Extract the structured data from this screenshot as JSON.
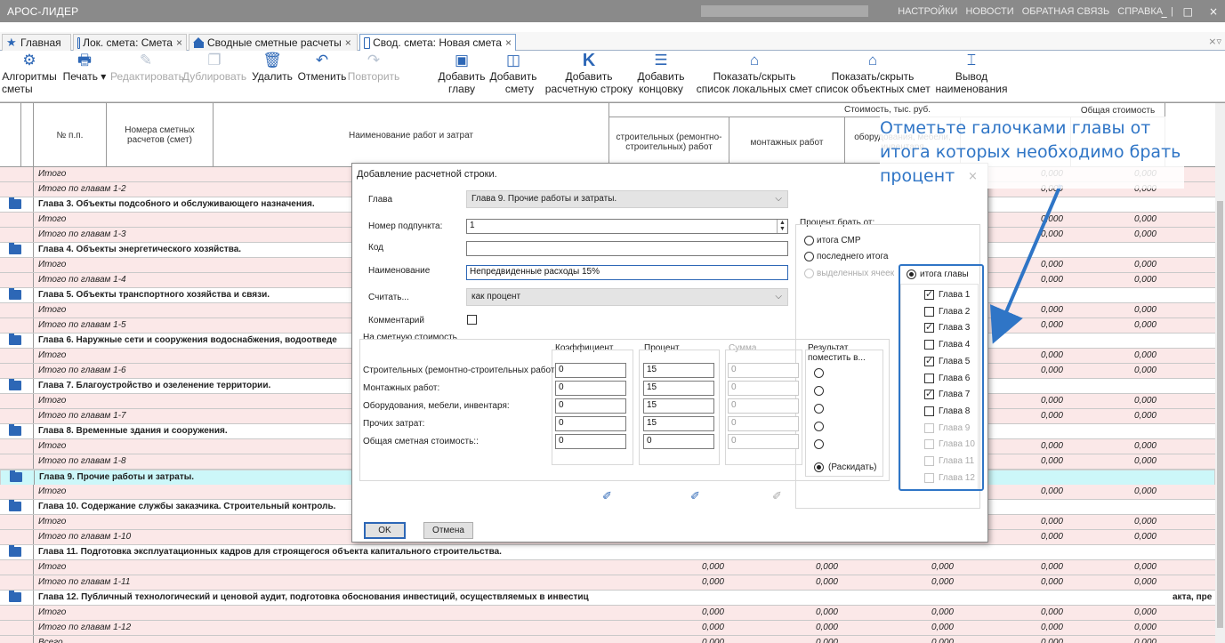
{
  "app": {
    "title": "АРОС-ЛИДЕР"
  },
  "menu": [
    "НАСТРОЙКИ",
    "НОВОСТИ",
    "ОБРАТНАЯ СВЯЗЬ",
    "СПРАВКА"
  ],
  "window_controls": {
    "minimize": "_",
    "maximize": "□",
    "close": "×"
  },
  "tabs": [
    {
      "label": "Главная",
      "icon": "star-icon"
    },
    {
      "label": "Лок. смета: Смета",
      "icon": "document-icon",
      "close": "×"
    },
    {
      "label": "Сводные сметные расчеты",
      "icon": "home-icon",
      "close": "×"
    },
    {
      "label": "Свод. смета: Новая смета",
      "icon": "document-icon",
      "close": "×",
      "active": true
    }
  ],
  "tabbar_controls": "×▿",
  "toolbar": [
    {
      "label1": "Алгоритмы",
      "label2": "сметы",
      "icon": "⚙"
    },
    {
      "label1": "Печать ▾",
      "label2": "",
      "icon": "🖶"
    },
    {
      "label1": "Редактировать",
      "label2": "",
      "icon": "✎",
      "disabled": true
    },
    {
      "label1": "Дублировать",
      "label2": "",
      "icon": "❐",
      "disabled": true
    },
    {
      "label1": "Удалить",
      "label2": "",
      "icon": "🗑"
    },
    {
      "label1": "Отменить",
      "label2": "",
      "icon": "↶"
    },
    {
      "label1": "Повторить",
      "label2": "",
      "icon": "↷",
      "disabled": true
    },
    {
      "label1": "Добавить",
      "label2": "главу",
      "icon": "▣"
    },
    {
      "label1": "Добавить",
      "label2": "смету",
      "icon": "◫"
    },
    {
      "label1": "Добавить",
      "label2": "расчетную строку",
      "icon": "K"
    },
    {
      "label1": "Добавить",
      "label2": "концовку",
      "icon": "☰"
    },
    {
      "label1": "Показать/скрыть",
      "label2": "список локальных смет",
      "icon": "⌂"
    },
    {
      "label1": "Показать/скрыть",
      "label2": "список объектных смет",
      "icon": "⌂"
    },
    {
      "label1": "Вывод",
      "label2": "наименования",
      "icon": "⌶"
    }
  ],
  "grid_header": {
    "num": "№ п.п.",
    "numbers": "Номера сметных расчетов (смет)",
    "name": "Наименование работ и затрат",
    "cost_group": "Стоимость, тыс. руб.",
    "col_build": "строительных (ремонтно-строительных) работ",
    "col_mount": "монтажных работ",
    "col_equip": "оборудования, мебели, инвентаря",
    "col_total": "Общая стоимость"
  },
  "rows": [
    {
      "type": "itogo",
      "name": "Итого",
      "values": [
        "",
        "",
        "",
        "0,000",
        "0,000"
      ]
    },
    {
      "type": "itogo",
      "name": "Итого по главам 1-2",
      "values": [
        "",
        "",
        "",
        "0,000",
        "0,000"
      ]
    },
    {
      "type": "chapter",
      "name": "Глава 3. Объекты подсобного и обслуживающего назначения."
    },
    {
      "type": "itogo",
      "name": "Итого",
      "values": [
        "",
        "",
        "",
        "0,000",
        "0,000"
      ]
    },
    {
      "type": "itogo",
      "name": "Итого по главам 1-3",
      "values": [
        "",
        "",
        "",
        "0,000",
        "0,000"
      ]
    },
    {
      "type": "chapter",
      "name": "Глава 4. Объекты энергетического хозяйства."
    },
    {
      "type": "itogo",
      "name": "Итого",
      "values": [
        "",
        "",
        "",
        "0,000",
        "0,000"
      ]
    },
    {
      "type": "itogo",
      "name": "Итого по главам 1-4",
      "values": [
        "",
        "",
        "",
        "0,000",
        "0,000"
      ]
    },
    {
      "type": "chapter",
      "name": "Глава 5. Объекты транспортного хозяйства и связи."
    },
    {
      "type": "itogo",
      "name": "Итого",
      "values": [
        "",
        "",
        "",
        "0,000",
        "0,000"
      ]
    },
    {
      "type": "itogo",
      "name": "Итого по главам 1-5",
      "values": [
        "",
        "",
        "",
        "0,000",
        "0,000"
      ]
    },
    {
      "type": "chapter",
      "name": "Глава 6. Наружные сети и сооружения водоснабжения, водоотведе"
    },
    {
      "type": "itogo",
      "name": "Итого",
      "values": [
        "",
        "",
        "",
        "0,000",
        "0,000"
      ]
    },
    {
      "type": "itogo",
      "name": "Итого по главам 1-6",
      "values": [
        "",
        "",
        "",
        "0,000",
        "0,000"
      ]
    },
    {
      "type": "chapter",
      "name": "Глава 7. Благоустройство и озеленение территории."
    },
    {
      "type": "itogo",
      "name": "Итого",
      "values": [
        "",
        "",
        "",
        "0,000",
        "0,000"
      ]
    },
    {
      "type": "itogo",
      "name": "Итого по главам 1-7",
      "values": [
        "",
        "",
        "",
        "0,000",
        "0,000"
      ]
    },
    {
      "type": "chapter",
      "name": "Глава 8. Временные здания и сооружения."
    },
    {
      "type": "itogo",
      "name": "Итого",
      "values": [
        "",
        "",
        "",
        "0,000",
        "0,000"
      ]
    },
    {
      "type": "itogo",
      "name": "Итого по главам 1-8",
      "values": [
        "",
        "",
        "",
        "0,000",
        "0,000"
      ]
    },
    {
      "type": "chapter",
      "name": "Глава 9. Прочие работы и затраты.",
      "selected": true
    },
    {
      "type": "itogo",
      "name": "Итого",
      "values": [
        "",
        "",
        "",
        "0,000",
        "0,000"
      ]
    },
    {
      "type": "chapter",
      "name": "Глава 10. Содержание службы заказчика. Строительный контроль."
    },
    {
      "type": "itogo",
      "name": "Итого",
      "values": [
        "",
        "",
        "",
        "0,000",
        "0,000"
      ]
    },
    {
      "type": "itogo",
      "name": "Итого по главам 1-10",
      "values": [
        "",
        "",
        "",
        "0,000",
        "0,000"
      ]
    },
    {
      "type": "chapter",
      "name": "Глава 11. Подготовка эксплуатационных кадров для строящегося объекта капитального строительства."
    },
    {
      "type": "itogo",
      "name": "Итого",
      "values": [
        "0,000",
        "0,000",
        "0,000",
        "0,000",
        "0,000"
      ]
    },
    {
      "type": "itogo",
      "name": "Итого по главам 1-11",
      "values": [
        "0,000",
        "0,000",
        "0,000",
        "0,000",
        "0,000"
      ]
    },
    {
      "type": "chapter",
      "name": "Глава 12. Публичный технологический и ценовой аудит, подготовка обоснования инвестиций, осуществляемых в инвестиц",
      "tail": "акта, пре"
    },
    {
      "type": "itogo",
      "name": "Итого",
      "values": [
        "0,000",
        "0,000",
        "0,000",
        "0,000",
        "0,000"
      ]
    },
    {
      "type": "itogo",
      "name": "Итого по главам 1-12",
      "values": [
        "0,000",
        "0,000",
        "0,000",
        "0,000",
        "0,000"
      ]
    },
    {
      "type": "itogo",
      "name": "Всего",
      "values": [
        "0,000",
        "0,000",
        "0,000",
        "0,000",
        "0,000"
      ]
    }
  ],
  "dialog": {
    "title": "Добавление расчетной строки.",
    "chapter_label": "Глава",
    "chapter_value": "Глава 9. Прочие работы и затраты.",
    "subitem_label": "Номер подпункта:",
    "subitem_value": "1",
    "code_label": "Код",
    "code_value": "",
    "name_label": "Наименование",
    "name_value": "Непредвиденные расходы 15%",
    "count_label": "Считать...",
    "count_value": "как процент",
    "comment_label": "Комментарий",
    "cost_group": "На сметную стоимость",
    "col_coef": "Коэффициент",
    "col_pct": "Процент",
    "col_sum": "Сумма",
    "col_result": "Результат поместить в...",
    "rows": [
      {
        "label": "Строительных (ремонтно-строительных работ):",
        "coef": "0",
        "pct": "15",
        "sum": "0"
      },
      {
        "label": "Монтажных работ:",
        "coef": "0",
        "pct": "15",
        "sum": "0"
      },
      {
        "label": "Оборудования, мебели, инвентаря:",
        "coef": "0",
        "pct": "15",
        "sum": "0"
      },
      {
        "label": "Прочих затрат:",
        "coef": "0",
        "pct": "15",
        "sum": "0"
      },
      {
        "label": "Общая сметная стоимость::",
        "coef": "0",
        "pct": "0",
        "sum": "0"
      }
    ],
    "spread_label": "(Раскидать)",
    "percent_from": "Процент брать от:",
    "opt_smr": "итога СМР",
    "opt_last": "последнего итога",
    "opt_selected": "выделенных ячеек",
    "opt_chapter": "итога главы",
    "chapters": [
      {
        "label": "Глава 1",
        "checked": true
      },
      {
        "label": "Глава 2",
        "checked": false
      },
      {
        "label": "Глава 3",
        "checked": true
      },
      {
        "label": "Глава 4",
        "checked": false
      },
      {
        "label": "Глава 5",
        "checked": true
      },
      {
        "label": "Глава 6",
        "checked": false
      },
      {
        "label": "Глава 7",
        "checked": true
      },
      {
        "label": "Глава 8",
        "checked": false
      },
      {
        "label": "Глава 9",
        "checked": false,
        "disabled": true
      },
      {
        "label": "Глава 10",
        "checked": false,
        "disabled": true
      },
      {
        "label": "Глава 11",
        "checked": false,
        "disabled": true
      },
      {
        "label": "Глава 12",
        "checked": false,
        "disabled": true
      }
    ],
    "ok": "OK",
    "cancel": "Отмена"
  },
  "annotation": {
    "text": "Отметьте галочками главы от итога которых необходимо брать процент",
    "close": "×",
    "color": "#2f75c6"
  }
}
